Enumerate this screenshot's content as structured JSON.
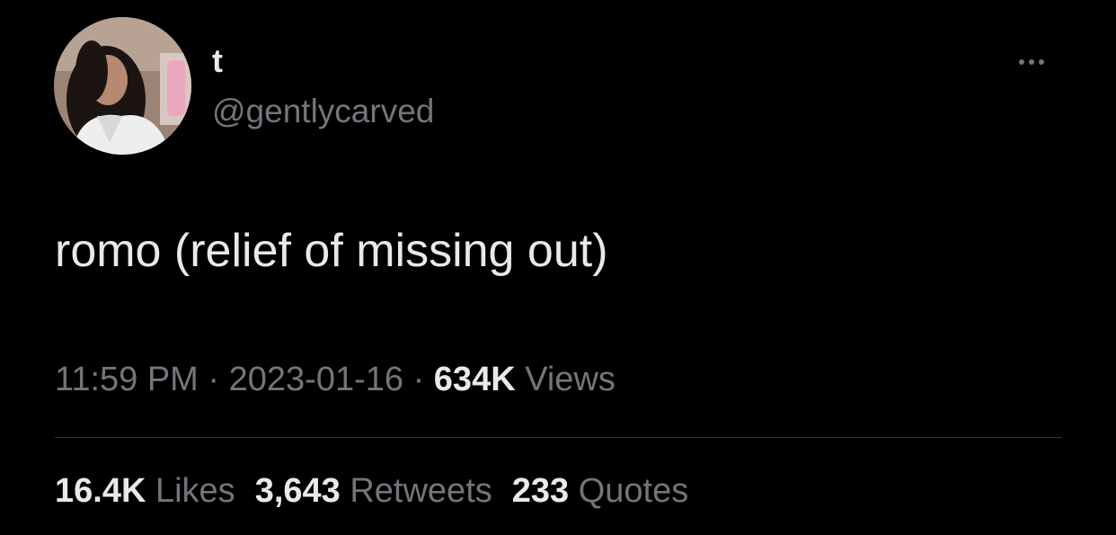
{
  "author": {
    "display_name": "t",
    "handle": "@gentlycarved",
    "avatar": "avatar-photo"
  },
  "more_icon": "more-horizontal-icon",
  "tweet": {
    "text": "romo (relief of missing out)",
    "time": "11:59 PM",
    "separator": "·",
    "date": "2023-01-16",
    "views_count": "634K",
    "views_label": "Views"
  },
  "stats": {
    "likes_count": "16.4K",
    "likes_label": "Likes",
    "retweets_count": "3,643",
    "retweets_label": "Retweets",
    "quotes_count": "233",
    "quotes_label": "Quotes"
  },
  "colors": {
    "background": "#000000",
    "primary_text": "#e7e9ea",
    "secondary_text": "#71767b",
    "divider": "#2f3336"
  }
}
